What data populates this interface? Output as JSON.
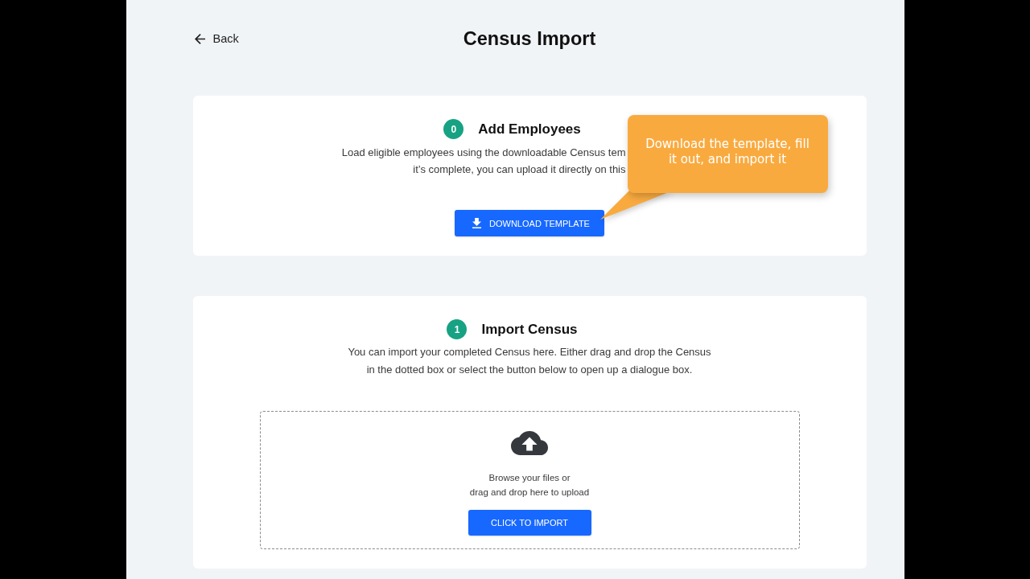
{
  "header": {
    "back": {
      "label": "Back"
    },
    "title": "Census Import"
  },
  "steps": [
    {
      "kind": "download",
      "number": "0",
      "title": "Add Employees",
      "description_lines": [
        "Load eligible employees using the downloadable Census tem",
        "it’s complete, you can upload it directly on this"
      ],
      "button": {
        "label": "DOWNLOAD TEMPLATE"
      },
      "tooltip": {
        "text": "Download the template, fill it out, and import it"
      }
    },
    {
      "kind": "upload",
      "number": "1",
      "title": "Import Census",
      "description_lines": [
        "You can import your completed Census here. Either drag and drop the Census",
        "in the dotted box or select the button below to open up a dialogue box."
      ],
      "dropzone": {
        "hint_lines": [
          "Browse your files or",
          "drag and drop here to upload"
        ],
        "button": {
          "label": "CLICK TO IMPORT"
        }
      }
    }
  ]
}
